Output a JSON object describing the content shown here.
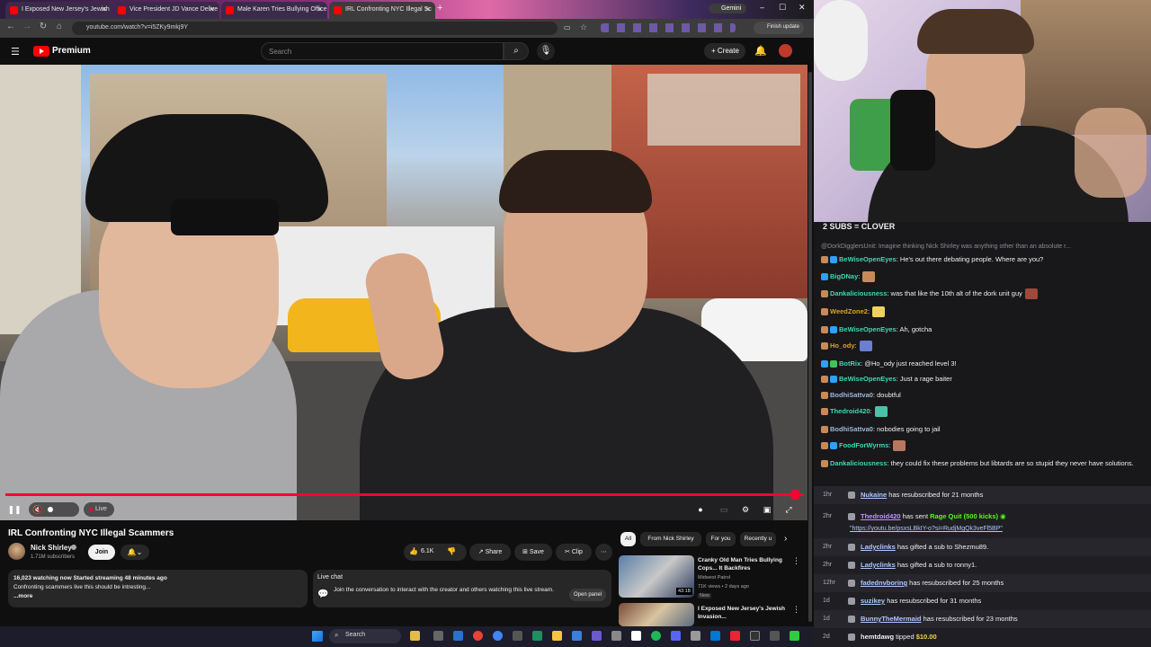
{
  "browser": {
    "tabs": [
      {
        "label": "I Exposed New Jersey's Jewish"
      },
      {
        "label": "Vice President JD Vance Delive"
      },
      {
        "label": "Male Karen Tries Bullying Office"
      },
      {
        "label": "IRL Confronting NYC Illegal Sc"
      }
    ],
    "url": "youtube.com/watch?v=i5ZKy9mkj9Y",
    "finish_update": "Finish update",
    "gemini": "Gemini",
    "accent": "#ff0033"
  },
  "youtube": {
    "brand": "Premium",
    "search_placeholder": "Search",
    "create_label": "+ Create",
    "video": {
      "title": "IRL Confronting NYC Illegal Scammers",
      "live_label": "Live"
    },
    "channel": {
      "name": "Nick Shirley",
      "subscribers": "1.71M subscribers",
      "join_label": "Join"
    },
    "actions": {
      "likes": "6.1K",
      "share": "Share",
      "save": "Save",
      "clip": "Clip"
    },
    "description": {
      "line1": "16,023 watching now  Started streaming 48 minutes ago",
      "line2": "Confronting scammers live this should be intresting...",
      "more": "...more"
    },
    "live_chat": {
      "title": "Live chat",
      "text": "Join the conversation to interact with the creator and others watching this live stream.",
      "open_panel": "Open panel"
    },
    "chips": [
      "All",
      "From Nick Shirley",
      "For you",
      "Recently u"
    ],
    "recommendations": [
      {
        "title": "Cranky Old Man Tries Bullying Cops... It Backfires",
        "channel": "Midwest Patrol",
        "meta": "71K views • 2 days ago",
        "badge": "New",
        "duration": "43:18"
      },
      {
        "title": "I Exposed New Jersey's Jewish Invasion...",
        "channel": "",
        "meta": "",
        "badge": "",
        "duration": ""
      }
    ]
  },
  "taskbar": {
    "search": "Search"
  },
  "chat": {
    "header": "2 SUBS = CLOVER",
    "reply_context": "@DorkDigglersUnit: Imagine thinking Nick Shirley was anything other than an absolute r...",
    "messages": [
      {
        "user": "BeWiseOpenEyes",
        "color": "#3dd9b0",
        "text": " He's out there debating people. Where are you?"
      },
      {
        "user": "BigDNay",
        "color": "#3dd9b0",
        "text": ""
      },
      {
        "user": "Dankaliciousness",
        "color": "#3dd9b0",
        "text": " was that like the 10th alt of the dork unit guy"
      },
      {
        "user": "WeedZone2",
        "color": "#daa520",
        "text": ""
      },
      {
        "user": "BeWiseOpenEyes",
        "color": "#3dd9b0",
        "text": " Ah, gotcha"
      },
      {
        "user": "Ho_ody",
        "color": "#daa520",
        "text": ""
      },
      {
        "user": "BotRix",
        "color": "#3dd9b0",
        "text": " @Ho_ody just reached level 3!"
      },
      {
        "user": "BeWiseOpenEyes",
        "color": "#3dd9b0",
        "text": " Just a rage baiter"
      },
      {
        "user": "BodhiSattva0",
        "color": "#9eb8d9",
        "text": " doubtful"
      },
      {
        "user": "Thedroid420",
        "color": "#3dd9b0",
        "text": ""
      },
      {
        "user": "BodhiSattva0",
        "color": "#9eb8d9",
        "text": " nobodies going to jail"
      },
      {
        "user": "FoodForWyrms",
        "color": "#3dd9b0",
        "text": ""
      },
      {
        "user": "Dankaliciousness",
        "color": "#3dd9b0",
        "text": " they could fix these problems but libtards are so stupid they never have solutions."
      }
    ],
    "events": [
      {
        "time": "1hr",
        "name": "Nukaine",
        "text": " has resubscribed for 21 months"
      },
      {
        "time": "2hr",
        "name": "Thedroid420",
        "text": " has sent ",
        "extra": "Rage Quit (500 kicks)",
        "link": "\"https://youtu.be/psxsLBkIY-o?si=RudjMgQk3veFl5BP\""
      },
      {
        "time": "2hr",
        "name": "Ladyclinks",
        "text": " has gifted a sub to Shezmu89."
      },
      {
        "time": "2hr",
        "name": "Ladyclinks",
        "text": " has gifted a sub to ronny1."
      },
      {
        "time": "12hr",
        "name": "fadednvboring",
        "text": " has resubscribed for 25 months"
      },
      {
        "time": "1d",
        "name": "suzikey",
        "text": " has resubscribed for 31 months"
      },
      {
        "time": "1d",
        "name": "BunnyTheMermaid",
        "text": " has resubscribed for 23 months"
      },
      {
        "time": "2d",
        "name": "hemtdawg",
        "text": " tipped ",
        "extra": "$10.00"
      }
    ]
  }
}
